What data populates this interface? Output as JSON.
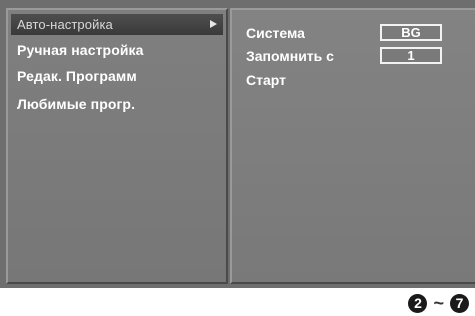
{
  "menu": {
    "items": [
      {
        "label": "Авто-настройка"
      },
      {
        "label": "Ручная настройка"
      },
      {
        "label": "Редак. Программ"
      },
      {
        "label": "Любимые прогр."
      }
    ]
  },
  "options": {
    "system_label": "Система",
    "system_value": "BG",
    "store_from_label": "Запомнить с",
    "store_from_value": "1",
    "start_label": "Старт"
  },
  "footer": {
    "step_from": "2",
    "separator": "~",
    "step_to": "7"
  }
}
